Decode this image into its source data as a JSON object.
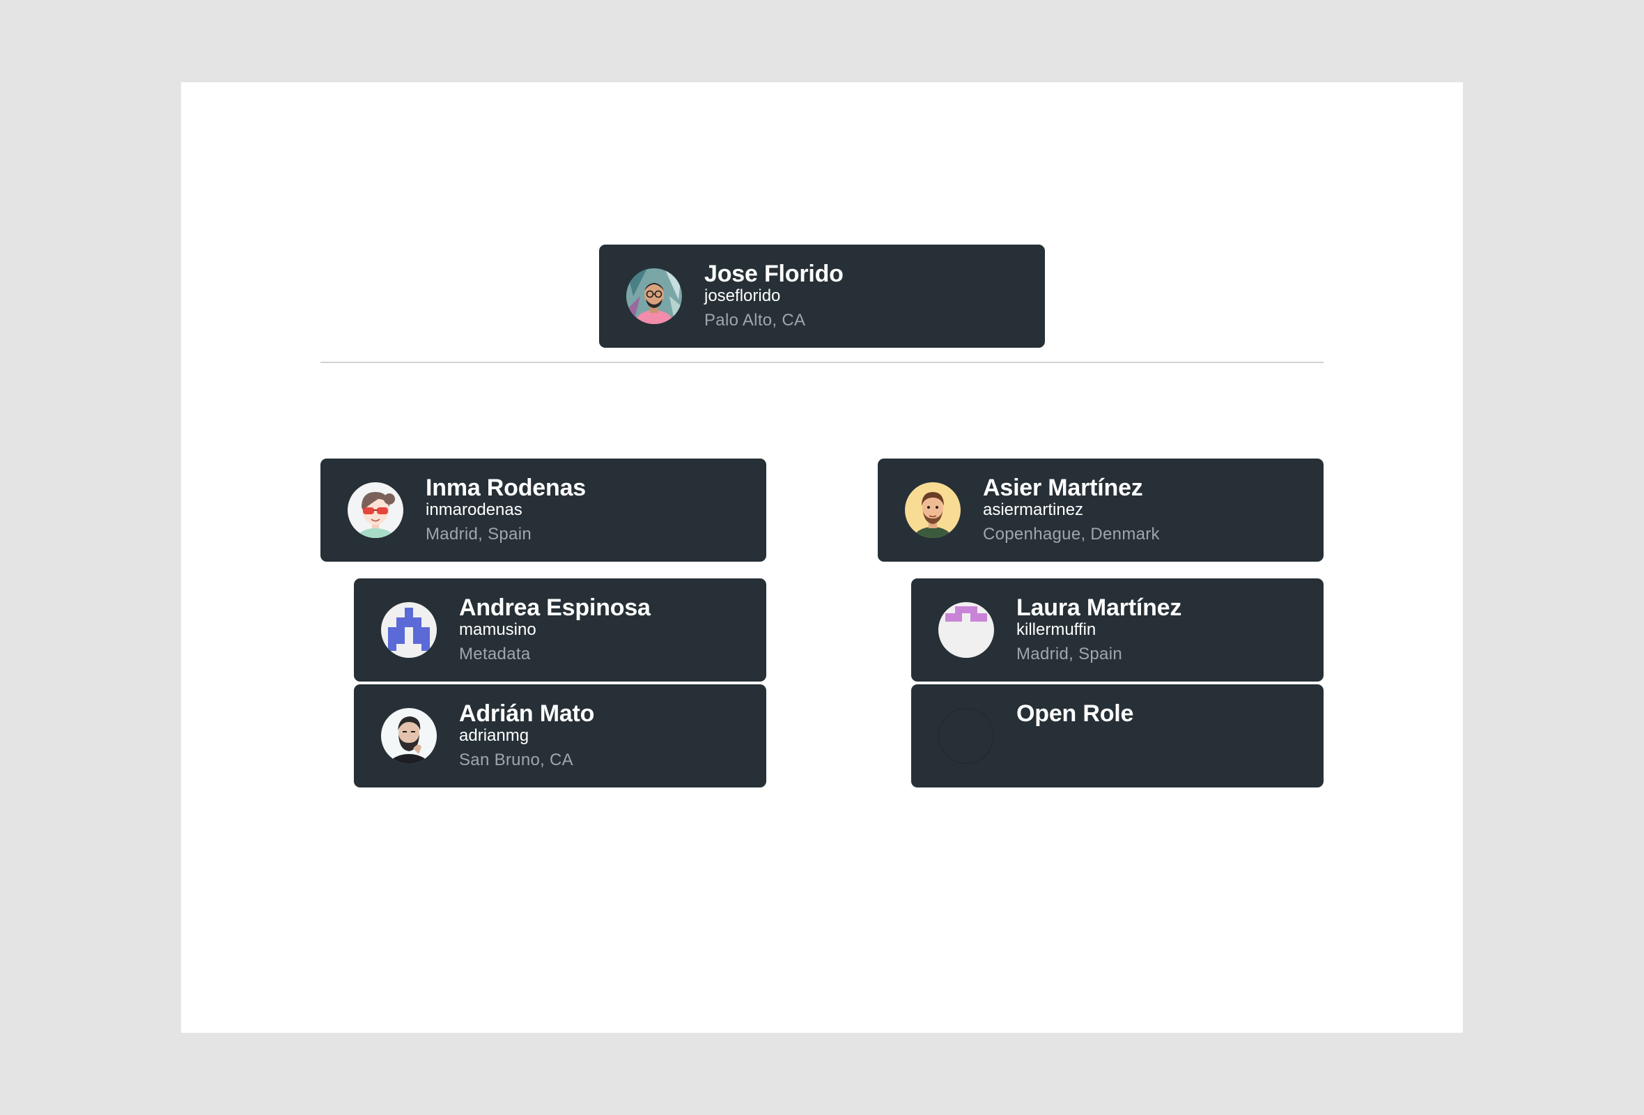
{
  "people": {
    "root": {
      "name": "Jose Florido",
      "handle": "joseflorido",
      "location": "Palo Alto, CA"
    },
    "inma": {
      "name": "Inma Rodenas",
      "handle": "inmarodenas",
      "location": "Madrid, Spain"
    },
    "andrea": {
      "name": "Andrea Espinosa",
      "handle": "mamusino",
      "location": "Metadata"
    },
    "adrian": {
      "name": "Adrián Mato",
      "handle": "adrianmg",
      "location": "San Bruno, CA"
    },
    "asier": {
      "name": "Asier Martínez",
      "handle": "asiermartinez",
      "location": "Copenhague, Denmark"
    },
    "laura": {
      "name": "Laura Martínez",
      "handle": "killermuffin",
      "location": "Madrid, Spain"
    },
    "open": {
      "name": "Open Role"
    }
  },
  "colors": {
    "background": "#e4e4e4",
    "canvas": "#ffffff",
    "card": "#263036",
    "location_text": "#9fa7ab"
  }
}
